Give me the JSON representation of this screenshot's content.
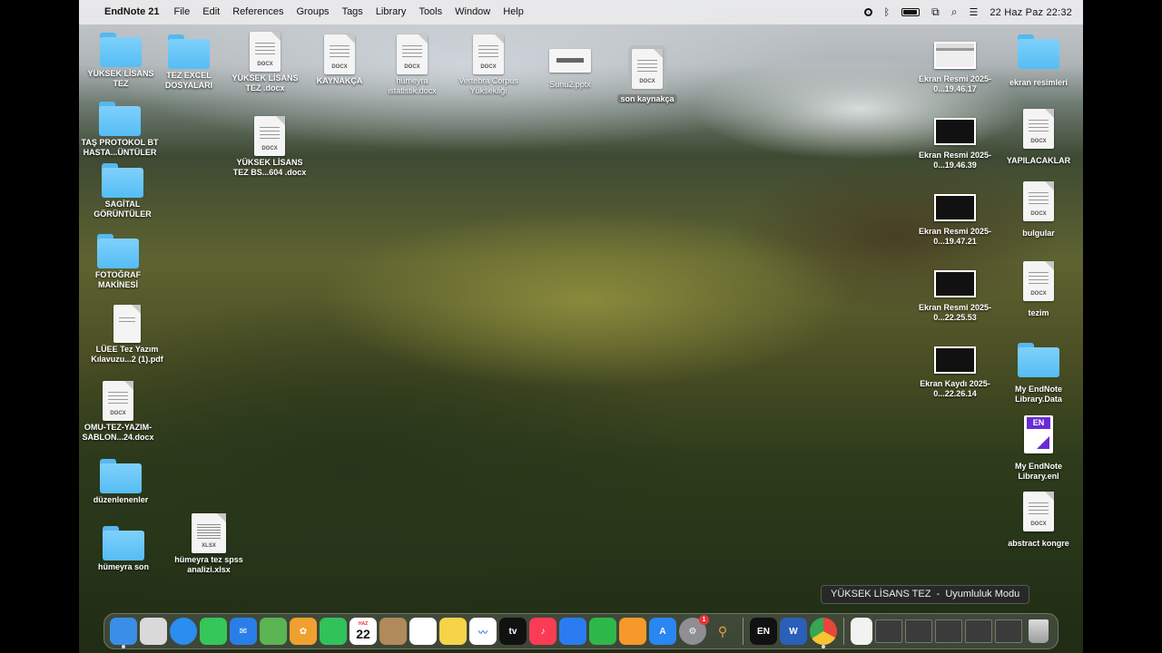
{
  "menubar": {
    "app_name": "EndNote 21",
    "menus": [
      "File",
      "Edit",
      "References",
      "Groups",
      "Tags",
      "Library",
      "Tools",
      "Window",
      "Help"
    ],
    "datetime": "22 Haz Paz  22:32"
  },
  "desktop": {
    "left_icons": [
      {
        "label": "YÜKSEK LİSANS TEZ",
        "kind": "folder"
      },
      {
        "label": "TEZ EXCEL DOSYALARI",
        "kind": "folder"
      },
      {
        "label": "YÜKSEK LİSANS TEZ .docx",
        "kind": "doc",
        "tag": "DOCX"
      },
      {
        "label": "KAYNAKÇA",
        "kind": "doc",
        "tag": "DOCX"
      },
      {
        "label": "hümeyra istatistik.docx",
        "kind": "doc",
        "tag": "DOCX"
      },
      {
        "label": "Vertebra Corpus Yüksekliği",
        "kind": "doc",
        "tag": "DOCX"
      },
      {
        "label": "Sunu2.pptx",
        "kind": "slide"
      },
      {
        "label": "son kaynakça",
        "kind": "doc",
        "tag": "DOCX",
        "selected": true
      },
      {
        "label": "TAŞ PROTOKOL BT HASTA...ÜNTÜLER",
        "kind": "folder"
      },
      {
        "label": "YÜKSEK LİSANS TEZ BS...604 .docx",
        "kind": "doc",
        "tag": "DOCX"
      },
      {
        "label": "SAGİTAL GÖRÜNTÜLER",
        "kind": "folder"
      },
      {
        "label": "FOTOĞRAF MAKİNESİ",
        "kind": "folder"
      },
      {
        "label": "LÜEE Tez Yazım Kılavuzu...2 (1).pdf",
        "kind": "doc",
        "tag": ""
      },
      {
        "label": "OMU-TEZ-YAZIM-SABLON...24.docx",
        "kind": "doc",
        "tag": "DOCX"
      },
      {
        "label": "düzenlenenler",
        "kind": "folder"
      },
      {
        "label": "hümeyra son",
        "kind": "folder"
      },
      {
        "label": "hümeyra tez spss analizi.xlsx",
        "kind": "doc",
        "tag": "XLSX"
      }
    ],
    "right_icons": [
      {
        "label": "Ekran Resmi 2025-0...19.46.17",
        "kind": "thumb-light"
      },
      {
        "label": "ekran resimleri",
        "kind": "folder"
      },
      {
        "label": "Ekran Resmi 2025-0...19.46.39",
        "kind": "thumb"
      },
      {
        "label": "YAPILACAKLAR",
        "kind": "doc",
        "tag": "DOCX"
      },
      {
        "label": "Ekran Resmi 2025-0...19.47.21",
        "kind": "thumb"
      },
      {
        "label": "bulgular",
        "kind": "doc",
        "tag": "DOCX"
      },
      {
        "label": "Ekran Resmi 2025-0...22.25.53",
        "kind": "thumb"
      },
      {
        "label": "tezim",
        "kind": "doc",
        "tag": "DOCX"
      },
      {
        "label": "Ekran Kaydı 2025-0...22.26.14",
        "kind": "thumb"
      },
      {
        "label": "My EndNote Library.Data",
        "kind": "folder"
      },
      {
        "label": "My EndNote Library.enl",
        "kind": "enl",
        "badge": "EN"
      },
      {
        "label": "abstract kongre",
        "kind": "doc",
        "tag": "DOCX"
      }
    ]
  },
  "tooltip": "YÜKSEK LİSANS TEZ  -  Uyumluluk Modu",
  "dock": {
    "calendar_month": "HAZ",
    "calendar_day": "22",
    "settings_badge": "1",
    "endnote_label": "EN",
    "word_label": "W",
    "tv_label": "tv",
    "colors": {
      "finder": "#3b8ee8",
      "launchpad": "#d9d9d9",
      "safari": "#2b8df0",
      "messages": "#35c759",
      "mail": "#2a7ee8",
      "maps": "#5ab552",
      "photos": "#f0a030",
      "facetime": "#32c25a",
      "contacts": "#b08a5a",
      "reminders": "#ffffff",
      "notes": "#f6d44a",
      "freeform": "#ffffff",
      "tv": "#111111",
      "music": "#fa3c55",
      "keynote": "#2b7cf0",
      "numbers": "#2fb84a",
      "pages": "#f59a2a",
      "appstore": "#2a86f0",
      "settings": "#8e8e93",
      "endnote": "#111111",
      "word": "#2b5fb8",
      "chrome": "#e8453c"
    }
  }
}
